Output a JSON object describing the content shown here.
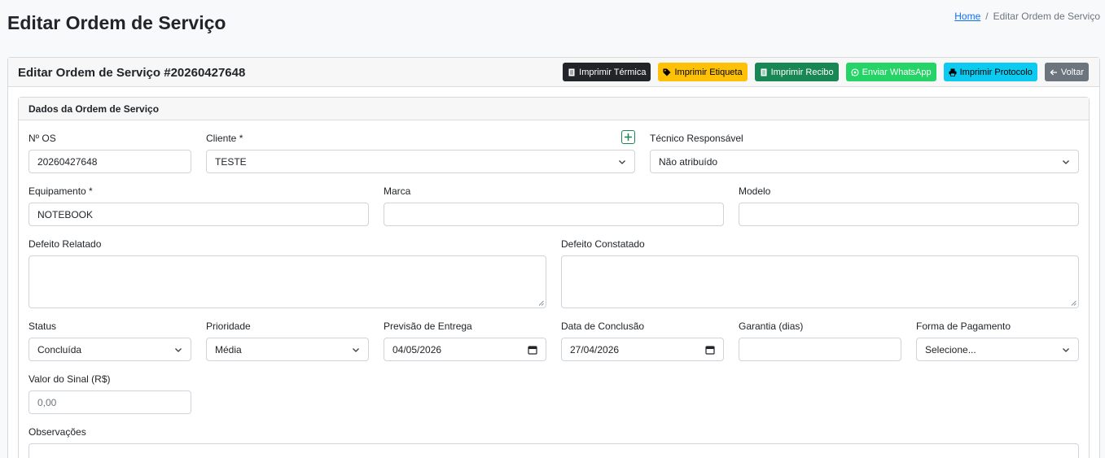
{
  "page": {
    "title": "Editar Ordem de Serviço",
    "breadcrumb": {
      "home": "Home",
      "separator": "/",
      "current": "Editar Ordem de Serviço"
    }
  },
  "card": {
    "title": "Editar Ordem de Serviço #20260427648",
    "buttons": [
      {
        "label": "Imprimir Térmica",
        "icon": "receipt-icon",
        "bg": "#212529",
        "fg": "#ffffff"
      },
      {
        "label": "Imprimir Etiqueta",
        "icon": "tag-icon",
        "bg": "#ffc107",
        "fg": "#000000"
      },
      {
        "label": "Imprimir Recibo",
        "icon": "receipt-icon",
        "bg": "#198754",
        "fg": "#ffffff"
      },
      {
        "label": "Enviar WhatsApp",
        "icon": "whatsapp-icon",
        "bg": "#25d366",
        "fg": "#ffffff"
      },
      {
        "label": "Imprimir Protocolo",
        "icon": "printer-icon",
        "bg": "#0dcaf0",
        "fg": "#000000"
      },
      {
        "label": "Voltar",
        "icon": "arrow-left-icon",
        "bg": "#6c757d",
        "fg": "#ffffff"
      }
    ]
  },
  "section": {
    "title": "Dados da Ordem de Serviço",
    "fields": {
      "numero_os": {
        "label": "Nº OS",
        "value": "20260427648"
      },
      "cliente": {
        "label": "Cliente *",
        "value": "TESTE"
      },
      "tecnico": {
        "label": "Técnico Responsável",
        "value": "Não atribuído"
      },
      "equipamento": {
        "label": "Equipamento *",
        "value": "NOTEBOOK"
      },
      "marca": {
        "label": "Marca",
        "value": ""
      },
      "modelo": {
        "label": "Modelo",
        "value": ""
      },
      "defeito_relatado": {
        "label": "Defeito Relatado",
        "value": ""
      },
      "defeito_constatado": {
        "label": "Defeito Constatado",
        "value": ""
      },
      "status": {
        "label": "Status",
        "value": "Concluída"
      },
      "prioridade": {
        "label": "Prioridade",
        "value": "Média"
      },
      "previsao": {
        "label": "Previsão de Entrega",
        "value": "04/05/2026"
      },
      "conclusao": {
        "label": "Data de Conclusão",
        "value": "27/04/2026"
      },
      "garantia": {
        "label": "Garantia (dias)",
        "value": ""
      },
      "pagamento": {
        "label": "Forma de Pagamento",
        "value": "Selecione..."
      },
      "sinal": {
        "label": "Valor do Sinal (R$)",
        "placeholder": "0,00"
      },
      "observacoes": {
        "label": "Observações",
        "value": ""
      }
    }
  },
  "colors": {
    "accent": "#0d6efd",
    "border": "#ced4da",
    "success": "#198754"
  }
}
